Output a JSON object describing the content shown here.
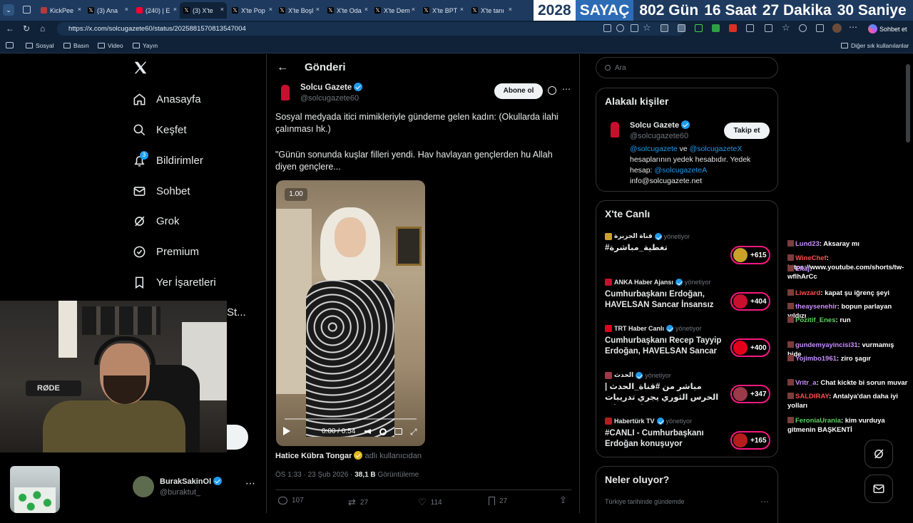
{
  "browser": {
    "tabs": [
      {
        "label": "KickPee",
        "fav_color": "#b53b3b"
      },
      {
        "label": "(3) Ana",
        "fav_color": "#000000"
      },
      {
        "label": "(240) | E",
        "fav_color": "#ff0033"
      },
      {
        "label": "(3) X'te",
        "fav_color": "#000000"
      },
      {
        "label": "X'te Pop",
        "fav_color": "#000000"
      },
      {
        "label": "X'te Boşl",
        "fav_color": "#000000"
      },
      {
        "label": "X'te Oda",
        "fav_color": "#000000"
      },
      {
        "label": "X'te Dem",
        "fav_color": "#000000"
      },
      {
        "label": "X'te BPT",
        "fav_color": "#000000"
      },
      {
        "label": "X'te tanı",
        "fav_color": "#000000"
      }
    ],
    "url": "https://x.com/solcugazete60/status/2025881570813547004",
    "sohbet_label": "Sohbet et",
    "bookmarks": [
      "Sosyal",
      "Basın",
      "Video",
      "Yayın"
    ],
    "other_bookmarks": "Diğer sık kullanılanlar"
  },
  "timer": {
    "year": "2028",
    "label": "SAYAÇ",
    "days": "802 Gün",
    "hours": "16 Saat",
    "minutes": "27 Dakika",
    "seconds": "30 Saniye"
  },
  "sidebar": {
    "items": [
      {
        "label": "Anasayfa",
        "icon": "home-icon"
      },
      {
        "label": "Keşfet",
        "icon": "search-icon"
      },
      {
        "label": "Bildirimler",
        "icon": "bell-icon",
        "badge": "3"
      },
      {
        "label": "Sohbet",
        "icon": "mail-icon"
      },
      {
        "label": "Grok",
        "icon": "grok-icon"
      },
      {
        "label": "Premium",
        "icon": "premium-icon"
      },
      {
        "label": "Yer İşaretleri",
        "icon": "bookmark-icon"
      }
    ],
    "partial_label": "St...",
    "account": {
      "name": "BurakSakinOl",
      "handle": "@buraktut_"
    }
  },
  "post": {
    "header_title": "Gönderi",
    "author_name": "Solcu Gazete",
    "author_handle": "@solcugazete60",
    "subscribe_label": "Abone ol",
    "text_1": "Sosyal medyada itici mimikleriyle gündeme gelen kadın: (Okullarda ilahi çalınması hk.)",
    "text_2": "\"Günün sonunda kuşlar filleri yendi. Hav havlayan gençlerden hu Allah diyen gençlere...",
    "video_speed": "1.00",
    "video_time": "0:00 / 0:54",
    "tagged_user": "Hatice Kübra Tongar",
    "tagged_suffix": "adlı kullanıcıdan",
    "timestamp": "ÖS 1:33 · 23 Şub 2026 ·",
    "views": "38,1 B",
    "views_label": "Görüntüleme",
    "replies": "107",
    "reposts": "27",
    "likes": "114",
    "bookmarks": "27"
  },
  "right": {
    "search_placeholder": "Ara",
    "related_title": "Alakalı kişiler",
    "related": {
      "name": "Solcu Gazete",
      "handle": "@solcugazete60",
      "follow_label": "Takip et",
      "bio_link_1": "@solcugazete",
      "bio_and": "ve",
      "bio_link_2": "@solcugazeteX",
      "bio_text": "hesaplarının yedek hesabıdır. Yedek hesap:",
      "bio_link_3": "@solcugazeteA",
      "bio_email": "info@solcugazete.net"
    },
    "live_title": "X'te Canlı",
    "live_items": [
      {
        "host": "قناة الجزيرة",
        "role": "yönetiyor",
        "title": "#تغطية_مباشرة",
        "count": "+615",
        "thumb": "#c9a227"
      },
      {
        "host": "ANKA Haber Ajansı",
        "role": "yönetiyor",
        "title": "Cumhurbaşkanı Erdoğan, HAVELSAN Sancar İnsansız ...",
        "count": "+404",
        "thumb": "#c8102e"
      },
      {
        "host": "TRT Haber Canlı",
        "role": "yönetiyor",
        "title": "Cumhurbaşkanı Recep Tayyip Erdoğan, HAVELSAN Sancar ...",
        "count": "+400",
        "thumb": "#e2001a"
      },
      {
        "host": "الحدث",
        "role": "yönetiyor",
        "title": "مباشر من #قناة_الحدث | الحرس الثوري يجري تدريبات عسكرية على ...",
        "count": "+347",
        "thumb": "#9b3a4a"
      },
      {
        "host": "Habertürk TV",
        "role": "yönetiyor",
        "title": "#CANLI - Cumhurbaşkanı Erdoğan konuşuyor",
        "count": "+165",
        "thumb": "#b71c1c"
      }
    ],
    "whats_happening_title": "Neler oluyor?",
    "trend_context": "Türkiye tarihinde gündemde"
  },
  "chat": [
    {
      "user": "Lund23",
      "color": "#c98cff",
      "msg": "Aksaray mı"
    },
    {
      "user": "WineChef",
      "color": "#ff4d4d",
      "msg": "https://www.youtube.com/shorts/tw-wflhArCc"
    },
    {
      "user": "Eltaj",
      "color": "#c98cff",
      "msg": ""
    },
    {
      "user": "Liwzard",
      "color": "#ff4d4d",
      "msg": "kapat şu iğrenç şeyi"
    },
    {
      "user": "theaysenehir",
      "color": "#c98cff",
      "msg": "bopun parlayan yıldızı"
    },
    {
      "user": "Pozitif_Enes",
      "color": "#5fd35f",
      "msg": "run"
    },
    {
      "user": "gundemyayincisi31",
      "color": "#c98cff",
      "msg": "vurmamış bide"
    },
    {
      "user": "Yojimbo1961",
      "color": "#c98cff",
      "msg": "ziro şagır"
    },
    {
      "user": "Vritr_a",
      "color": "#c98cff",
      "msg": "Chat kickte bi sorun muvar"
    },
    {
      "user": "SALDIRAY",
      "color": "#ff4d4d",
      "msg": "Antalya'dan daha iyi yolları"
    },
    {
      "user": "FeroniaUrania",
      "color": "#5fd35f",
      "msg": "kim vurduya gitmenin BAŞKENTİ"
    }
  ],
  "webcam": {
    "mic_brand": "RØDE"
  }
}
